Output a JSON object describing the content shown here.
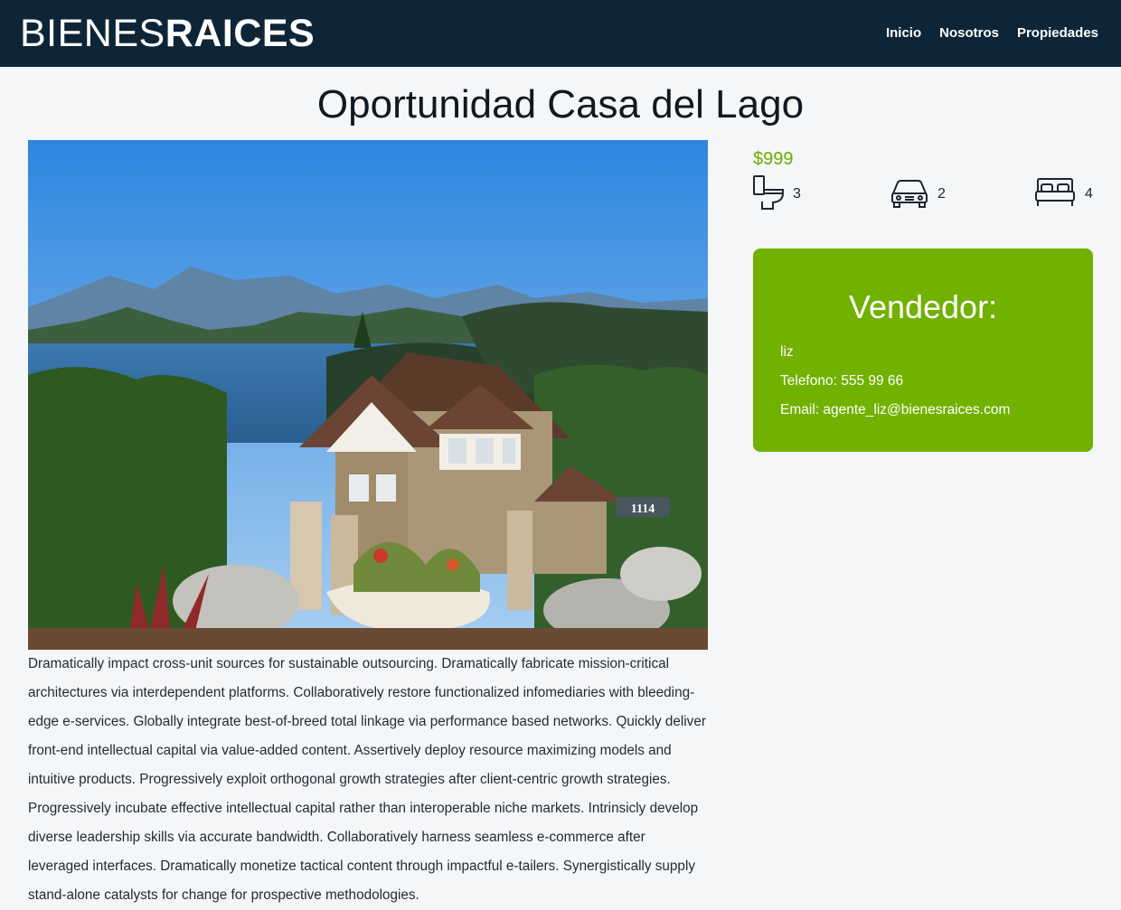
{
  "header": {
    "logo_light": "BIENES",
    "logo_bold": "RAICES",
    "nav": [
      "Inicio",
      "Nosotros",
      "Propiedades"
    ]
  },
  "property": {
    "title": "Oportunidad Casa del Lago",
    "price": "$999",
    "bathrooms": "3",
    "parking": "2",
    "bedrooms": "4",
    "description": "Dramatically impact cross-unit sources for sustainable outsourcing. Dramatically fabricate mission-critical architectures via interdependent platforms. Collaboratively restore functionalized infomediaries with bleeding-edge e-services. Globally integrate best-of-breed total linkage via performance based networks. Quickly deliver front-end intellectual capital via value-added content. Assertively deploy resource maximizing models and intuitive products. Progressively exploit orthogonal growth strategies after client-centric growth strategies. Progressively incubate effective intellectual capital rather than interoperable niche markets. Intrinsicly develop diverse leadership skills via accurate bandwidth. Collaboratively harness seamless e-commerce after leveraged interfaces. Dramatically monetize tactical content through impactful e-tailers. Synergistically supply stand-alone catalysts for change for prospective methodologies.",
    "image_number": "1114"
  },
  "seller": {
    "heading": "Vendedor:",
    "name": "liz",
    "phone": "Telefono: 555 99 66",
    "email": "Email: agente_liz@bienesraices.com"
  },
  "colors": {
    "header_bg": "#0d2537",
    "accent": "#71b100",
    "price": "#6aab00",
    "page_bg": "#f5f6f8"
  },
  "icons": [
    "toilet-icon",
    "car-icon",
    "bed-icon"
  ]
}
